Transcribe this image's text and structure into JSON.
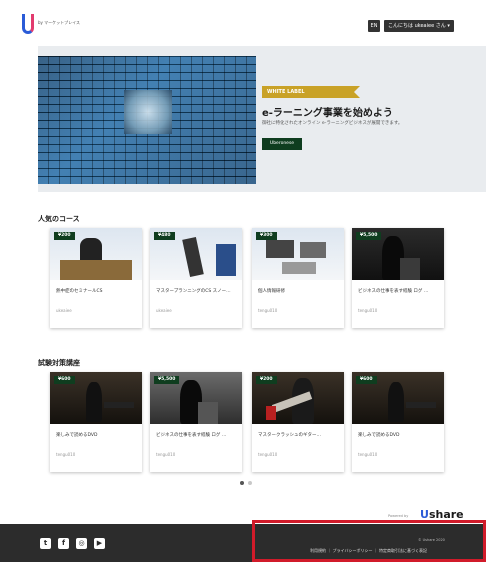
{
  "header": {
    "logo_text": "by\nマーケットプレイス",
    "lang": "EN",
    "user_label": "こんにちは ukeaiee さん ▾"
  },
  "hero": {
    "label": "WHITE LABEL",
    "title": "e-ラーニング事業を始めよう",
    "subtitle": "御社に特化されたオンライン e-ラーニングビジネスが展開できます。",
    "button": "Uberonese"
  },
  "sections": [
    {
      "title": "人気のコース",
      "cards": [
        {
          "price": "¥200",
          "title": "熱中症のセミナールCS",
          "author": "ukeaiee"
        },
        {
          "price": "¥480",
          "title": "マスタープランニングのCS スノー…",
          "author": "ukeaiee"
        },
        {
          "price": "¥300",
          "title": "個人情報研修",
          "author": "tengu010"
        },
        {
          "price": "¥5,500",
          "title": "ビジネスの仕事を表す経験 ログ …",
          "author": "tengu010"
        }
      ]
    },
    {
      "title": "試験対策講座",
      "cards": [
        {
          "price": "¥600",
          "title": "楽しみで読めるDVD",
          "author": "tengu010"
        },
        {
          "price": "¥5,500",
          "title": "ビジネスの仕事を表す経験 ログ …",
          "author": "tengu010"
        },
        {
          "price": "¥200",
          "title": "マスタークラッシュのギター…",
          "author": "tengu010"
        },
        {
          "price": "¥600",
          "title": "楽しみで読めるDVD",
          "author": "tengu010"
        }
      ]
    }
  ],
  "footer": {
    "powered_by": "Powered by",
    "brand": "share",
    "brand_mark": "U",
    "copyright": "© Ushare  2020",
    "links": "利用規約 ｜ プライバシーポリシー ｜ 特定商取引法に基づく表記",
    "social_icons": [
      "twitter-icon",
      "facebook-icon",
      "instagram-icon",
      "youtube-icon"
    ]
  },
  "colors": {
    "price_bg": "#0f3d1f",
    "label_bg": "#c9a227",
    "footer_bg": "#2c2c2c",
    "highlight": "#d11b2a"
  }
}
